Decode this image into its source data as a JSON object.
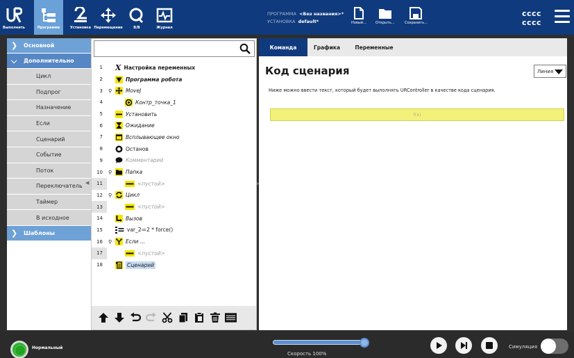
{
  "header": {
    "buttons": [
      {
        "label": "Выполнить",
        "icon": "ur-logo-icon"
      },
      {
        "label": "Программа",
        "icon": "program-tree-icon",
        "active": true
      },
      {
        "label": "Установка",
        "icon": "installation-icon"
      },
      {
        "label": "Перемещение",
        "icon": "move-icon"
      },
      {
        "label": "В/В",
        "icon": "io-icon"
      },
      {
        "label": "Журнал",
        "icon": "log-icon"
      }
    ],
    "program_label": "ПРОГРАММА",
    "program_value": "<Без названия>*",
    "installation_label": "УСТАНОВКА",
    "installation_value": "default*",
    "file_new": "Новый...",
    "file_open": "Открыть...",
    "file_save": "Сохранить...",
    "robot_name_1": "cccc",
    "robot_name_2": "cccc"
  },
  "leftnav": {
    "basic": "Основной",
    "advanced": "Дополнительно",
    "items": [
      "Цикл",
      "Подпрог",
      "Назначение",
      "Если",
      "Сценарий",
      "Событие",
      "Поток",
      "Переключатель",
      "Таймер",
      "В исходное"
    ],
    "templates": "Шаблоны"
  },
  "tree": {
    "search_placeholder": "",
    "rows": [
      {
        "num": "1",
        "icon": "x-variable-icon",
        "text": "Настройка переменных",
        "style": "bold",
        "indent": 0
      },
      {
        "num": "2",
        "icon": "triangle-down-icon",
        "text": "Программа робота",
        "style": "bolditalic",
        "indent": 0
      },
      {
        "num": "3",
        "icon": "movej-icon",
        "text": "MoveJ",
        "style": "italic",
        "indent": 0,
        "expand": true
      },
      {
        "num": "4",
        "icon": "waypoint-icon",
        "text": "Контр_точка_1",
        "style": "italic",
        "indent": 1
      },
      {
        "num": "5",
        "icon": "set-icon",
        "text": "Установить",
        "style": "italic",
        "indent": 0
      },
      {
        "num": "6",
        "icon": "hourglass-icon",
        "text": "Ожидание",
        "style": "italic",
        "indent": 0
      },
      {
        "num": "7",
        "icon": "popup-icon",
        "text": "Всплывающее окно",
        "style": "italic",
        "indent": 0
      },
      {
        "num": "8",
        "icon": "stop-icon",
        "text": "Останов",
        "style": "normal",
        "indent": 0
      },
      {
        "num": "9",
        "icon": "comment-icon",
        "text": "Комментарий",
        "style": "dim",
        "indent": 0
      },
      {
        "num": "10",
        "icon": "folder-icon",
        "text": "Папка",
        "style": "italic",
        "indent": 0,
        "expand": true
      },
      {
        "num": "11",
        "icon": "empty-icon",
        "text": "<пустой>",
        "style": "dim",
        "indent": 1,
        "grey": true
      },
      {
        "num": "12",
        "icon": "loop-icon",
        "text": "Цикл",
        "style": "italic",
        "indent": 0,
        "expand": true
      },
      {
        "num": "13",
        "icon": "empty-icon",
        "text": "<пустой>",
        "style": "dim",
        "indent": 1,
        "grey": true
      },
      {
        "num": "14",
        "icon": "call-icon",
        "text": "Вызов",
        "style": "italic",
        "indent": 0
      },
      {
        "num": "15",
        "icon": "assignment-icon",
        "text": "var_2≔2 * force()",
        "style": "normal",
        "indent": 0
      },
      {
        "num": "16",
        "icon": "if-icon",
        "text": "Если ...",
        "style": "italic",
        "indent": 0,
        "expand": true
      },
      {
        "num": "17",
        "icon": "empty-icon",
        "text": "<пустой>",
        "style": "dim",
        "indent": 1,
        "grey": true
      },
      {
        "num": "18",
        "icon": "script-icon",
        "text": "Сценарий",
        "style": "italic",
        "indent": 0,
        "selected": true
      }
    ],
    "toolbar": [
      "move-up-icon",
      "move-down-icon",
      "undo-icon",
      "redo-icon",
      "cut-icon",
      "copy-icon",
      "paste-icon",
      "delete-icon",
      "suppress-icon"
    ]
  },
  "content": {
    "tabs": [
      "Команда",
      "Графика",
      "Переменные"
    ],
    "title": "Код сценария",
    "mode": "Линия",
    "description": "Ниже можно ввести текст, который будет выполнять URController в качестве кода сценария.",
    "expression_placeholder": "f(x)"
  },
  "footer": {
    "status": "Нормальный",
    "speed": "Скорость 100%",
    "speed_value": 1.0,
    "simulation": "Симуляция"
  },
  "colors": {
    "header_bg": "#0f3a7d",
    "nav_blue": "#6ea1d6",
    "expr_yellow": "#f2f27a",
    "status_green": "#2bb32b"
  }
}
